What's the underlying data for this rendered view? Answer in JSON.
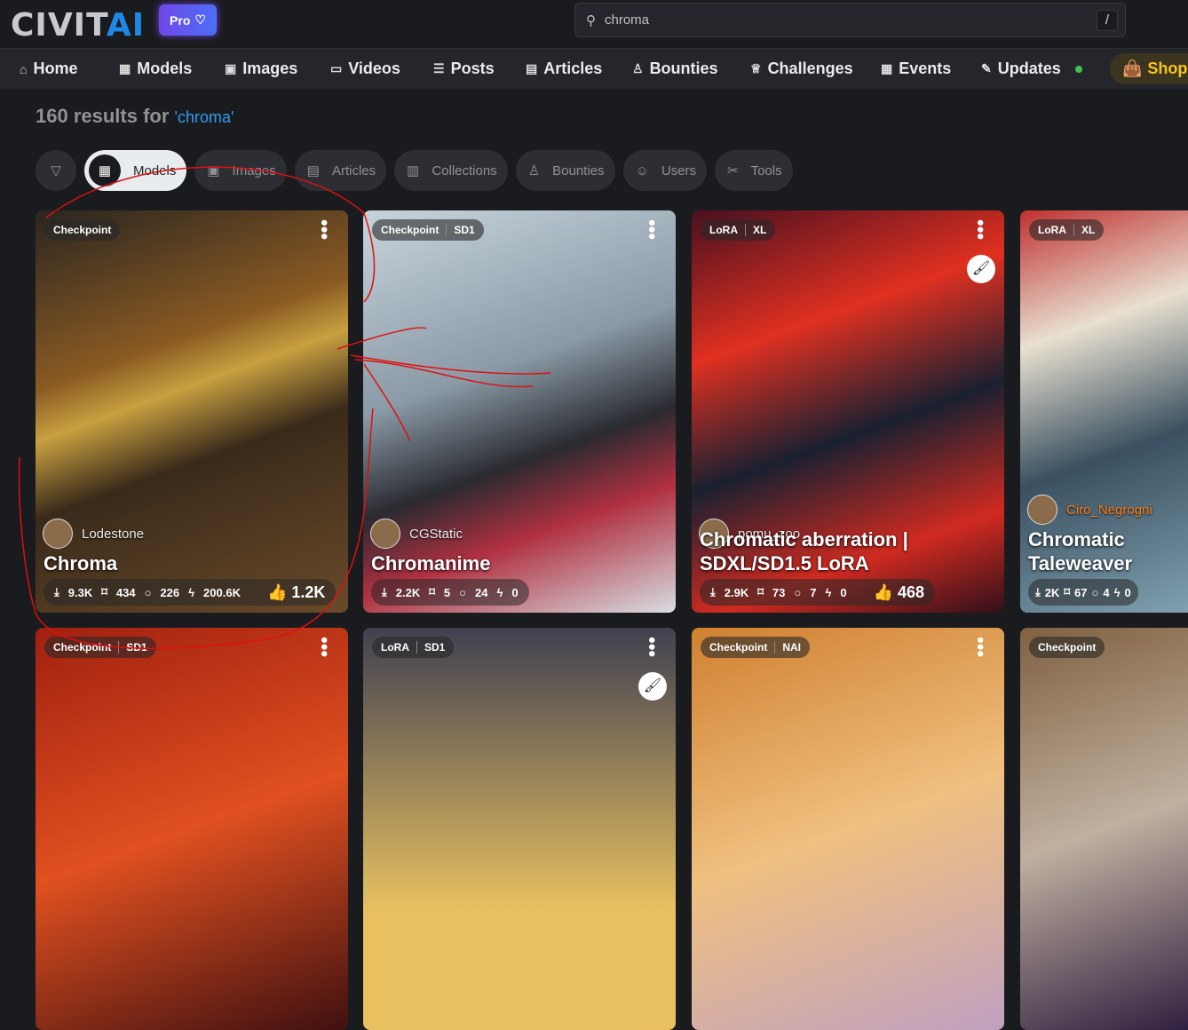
{
  "header": {
    "logo_a": "CIVIT",
    "logo_b": "AI",
    "pro_label": "Pro",
    "search_value": "chroma",
    "search_shortcut": "/"
  },
  "nav": [
    {
      "label": "Home",
      "icon": "⌂"
    },
    {
      "label": "Models",
      "icon": "▦"
    },
    {
      "label": "Images",
      "icon": "▣"
    },
    {
      "label": "Videos",
      "icon": "▭"
    },
    {
      "label": "Posts",
      "icon": "☰"
    },
    {
      "label": "Articles",
      "icon": "▤"
    },
    {
      "label": "Bounties",
      "icon": "♙"
    },
    {
      "label": "Challenges",
      "icon": "♕"
    },
    {
      "label": "Events",
      "icon": "▦"
    },
    {
      "label": "Updates",
      "icon": "✎"
    }
  ],
  "shop_label": "Shop",
  "results": {
    "count_text": "160 results for",
    "query": "'chroma'"
  },
  "filters": [
    {
      "label": "Models",
      "icon": "▦"
    },
    {
      "label": "Images",
      "icon": "▣"
    },
    {
      "label": "Articles",
      "icon": "▤"
    },
    {
      "label": "Collections",
      "icon": "▥"
    },
    {
      "label": "Bounties",
      "icon": "♙"
    },
    {
      "label": "Users",
      "icon": "☺"
    },
    {
      "label": "Tools",
      "icon": "✂"
    }
  ],
  "cards": [
    {
      "type": "Checkpoint",
      "base": "",
      "user": "Lodestone",
      "title": "Chroma",
      "downloads": "9.3K",
      "saves": "434",
      "comments": "226",
      "buzz": "200.6K",
      "likes": "1.2K"
    },
    {
      "type": "Checkpoint",
      "base": "SD1",
      "user": "CGStatic",
      "title": "Chromanime",
      "downloads": "2.2K",
      "saves": "5",
      "comments": "24",
      "buzz": "0",
      "likes": ""
    },
    {
      "type": "LoRA",
      "base": "XL",
      "user": "pomu_zoo",
      "title": "Chromatic aberration | SDXL/SD1.5 LoRA",
      "downloads": "2.9K",
      "saves": "73",
      "comments": "7",
      "buzz": "0",
      "likes": "468"
    },
    {
      "type": "LoRA",
      "base": "XL",
      "user": "Ciro_Negrogni",
      "title": "Chromatic Taleweaver",
      "downloads": "2K",
      "saves": "67",
      "comments": "4",
      "buzz": "0",
      "likes": ""
    },
    {
      "type": "Checkpoint",
      "base": "SD1"
    },
    {
      "type": "LoRA",
      "base": "SD1"
    },
    {
      "type": "Checkpoint",
      "base": "NAI"
    },
    {
      "type": "Checkpoint",
      "base": ""
    }
  ]
}
